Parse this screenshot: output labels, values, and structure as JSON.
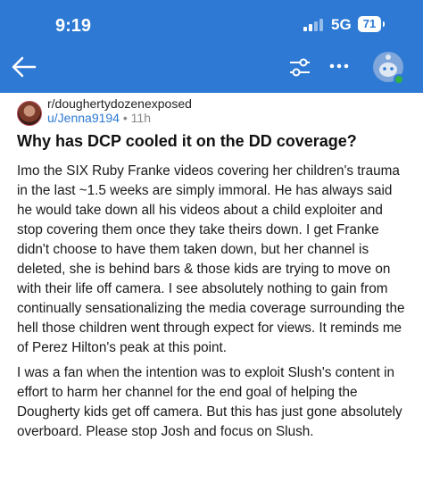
{
  "status": {
    "time": "9:19",
    "network": "5G",
    "battery": "71"
  },
  "nav": {
    "back_icon": "arrow-left-icon",
    "filter_icon": "sliders-icon",
    "more_icon": "more-dots-icon"
  },
  "post": {
    "subreddit": "r/doughertydozenexposed",
    "user": "u/Jenna9194",
    "separator": "•",
    "age": "11h",
    "title": "Why has DCP cooled it on the DD coverage?",
    "paragraphs": [
      "Imo the SIX Ruby Franke videos covering her children's trauma in the last ~1.5 weeks are simply immoral. He has always said he would take down all his videos about a child exploiter and stop covering them once they take theirs down. I get Franke didn't choose to have them taken down, but her channel is deleted, she is behind bars & those kids are trying to move on with their life off camera. I see absolutely nothing to gain from continually sensationalizing the media coverage surrounding the hell those children went through expect for views. It reminds me of Perez Hilton's peak at this point.",
      "I was a fan when the intention was to exploit Slush's content in effort to harm her channel for the end goal of helping the Dougherty kids get off camera. But this has just gone absolutely overboard. Please stop Josh and focus on Slush."
    ]
  },
  "colors": {
    "header": "#2d79d4",
    "link": "#2d79d4"
  }
}
